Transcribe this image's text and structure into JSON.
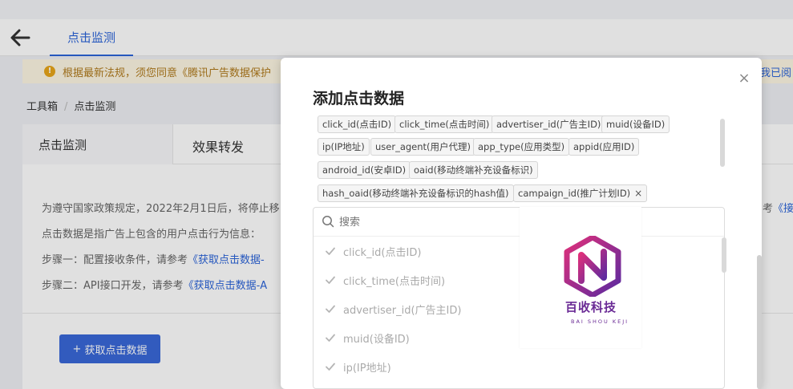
{
  "header": {
    "tab_label": "点击监测"
  },
  "notice": {
    "text": "根据最新法规，须您同意《腾讯广告数据保护",
    "right_fragment": "我已阅"
  },
  "breadcrumb": {
    "root": "工具箱",
    "current": "点击监测"
  },
  "tabs": {
    "active": "点击监测",
    "second": "效果转发"
  },
  "description": {
    "line1": "为遵守国家政策规定，2022年2月1日后，将停止移",
    "line1_right_prefix": "考",
    "line1_right_link": "《接",
    "line2": "点击数据是指广告上包含的用户点击行为信息：",
    "line3_prefix": "步骤一：配置接收条件，请参考",
    "line3_link": "《获取点击数据-",
    "line4_prefix": "步骤二：API接口开发，请参考",
    "line4_link": "《获取点击数据-A"
  },
  "get_button": {
    "plus": "+",
    "label": "获取点击数据"
  },
  "modal": {
    "title": "添加点击数据",
    "close": "×",
    "tags": [
      "click_id(点击ID)",
      "click_time(点击时间)",
      "advertiser_id(广告主ID)",
      "muid(设备ID)",
      "ip(IP地址)",
      "user_agent(用户代理)",
      "app_type(应用类型)",
      "appid(应用ID)",
      "android_id(安卓ID)",
      "oaid(移动终端补充设备标识)",
      "hash_oaid(移动终端补充设备标识的hash值)",
      "campaign_id(推广计划ID)"
    ],
    "tag_remove": "×",
    "search_placeholder": "搜索",
    "options": [
      "click_id(点击ID)",
      "click_time(点击时间)",
      "advertiser_id(广告主ID)",
      "muid(设备ID)",
      "ip(IP地址)"
    ]
  },
  "watermark": {
    "name_cn": "百收科技",
    "name_en": "BAI SHOU KEJI"
  },
  "colors": {
    "primary": "#2b63d9",
    "button": "#3968d9",
    "notice_bg": "#fdf6e3",
    "watermark": "#6a2a95"
  }
}
